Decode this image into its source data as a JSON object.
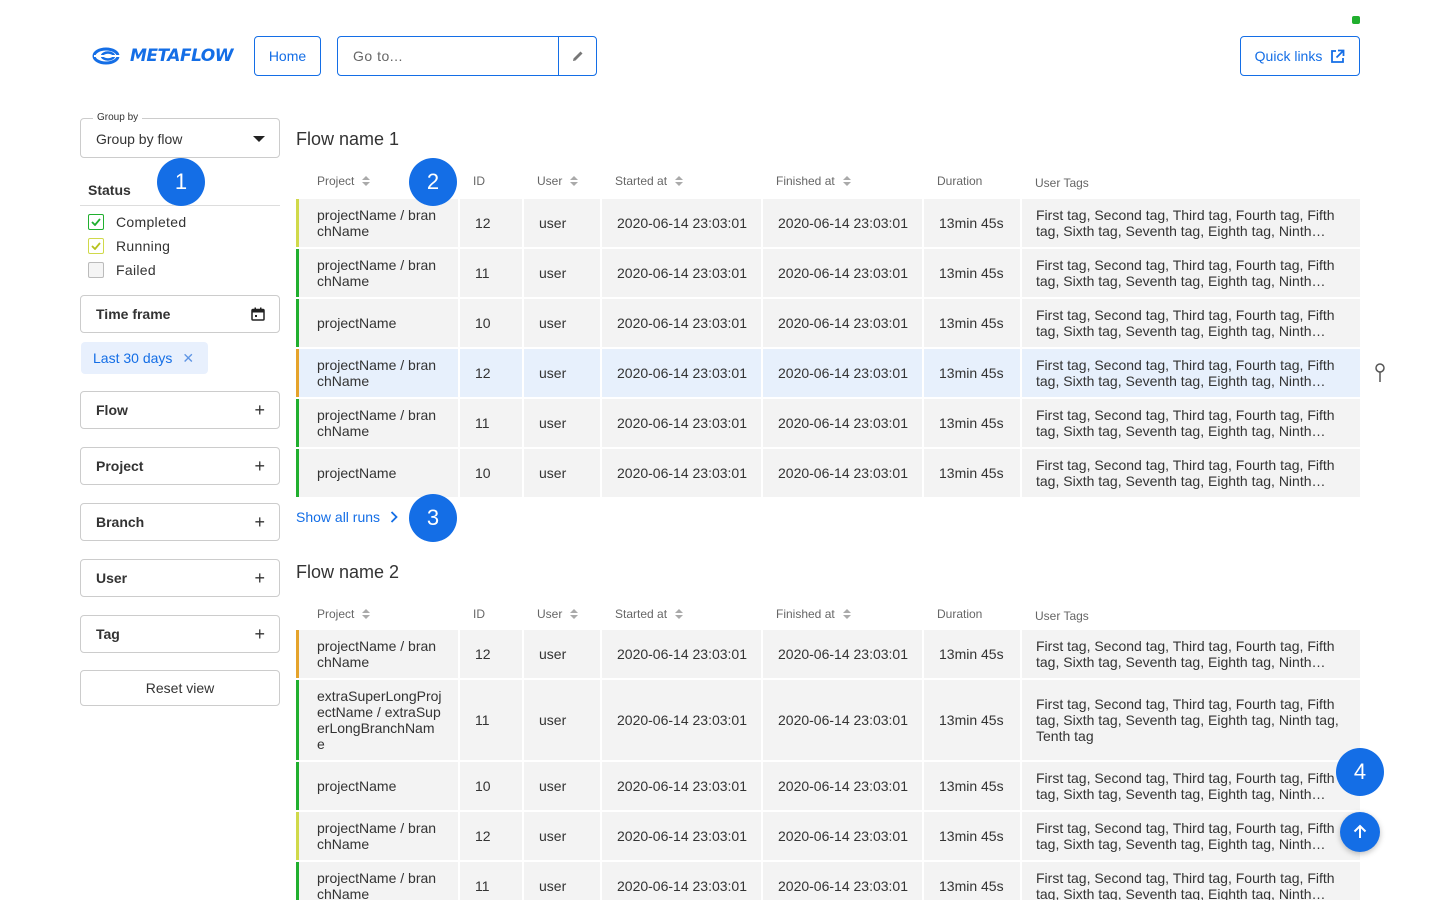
{
  "header": {
    "logo": "METAFLOW",
    "home_label": "Home",
    "goto_placeholder": "Go to...",
    "quick_links_label": "Quick links"
  },
  "sidebar": {
    "group_by": {
      "label": "Group by",
      "value": "Group by flow"
    },
    "status": {
      "title": "Status",
      "items": [
        {
          "label": "Completed",
          "checked": true,
          "color": "#20af2e"
        },
        {
          "label": "Running",
          "checked": true,
          "color": "#d0d94a"
        },
        {
          "label": "Failed",
          "checked": false
        }
      ]
    },
    "time_frame": {
      "label": "Time frame",
      "chip": "Last 30 days"
    },
    "filters": [
      "Flow",
      "Project",
      "Branch",
      "User",
      "Tag"
    ],
    "reset_label": "Reset view"
  },
  "columns": [
    "Project",
    "ID",
    "User",
    "Started at",
    "Finished at",
    "Duration",
    "User Tags"
  ],
  "groups": [
    {
      "title": "Flow name 1",
      "show_all_label": "Show all runs",
      "rows": [
        {
          "project": "projectName / branchName",
          "id": "12",
          "user": "user",
          "started": "2020-06-14 23:03:01",
          "finished": "2020-06-14 23:03:01",
          "duration": "13min 45s",
          "tags": "First tag, Second tag, Third tag, Fourth tag, Fifth tag, Sixth tag, Seventh tag, Eighth tag, Ninth tag,...",
          "status_color": "#d0d94a"
        },
        {
          "project": "projectName / branchName",
          "id": "11",
          "user": "user",
          "started": "2020-06-14 23:03:01",
          "finished": "2020-06-14 23:03:01",
          "duration": "13min 45s",
          "tags": "First tag, Second tag, Third tag, Fourth tag, Fifth tag, Sixth tag, Seventh tag, Eighth tag, Ninth tag,...",
          "status_color": "#20af2e"
        },
        {
          "project": "projectName",
          "id": "10",
          "user": "user",
          "started": "2020-06-14 23:03:01",
          "finished": "2020-06-14 23:03:01",
          "duration": "13min 45s",
          "tags": "First tag, Second tag, Third tag, Fourth tag, Fifth tag, Sixth tag, Seventh tag, Eighth tag, Ninth tag,...",
          "status_color": "#20af2e"
        },
        {
          "project": "projectName / branchName",
          "id": "12",
          "user": "user",
          "started": "2020-06-14 23:03:01",
          "finished": "2020-06-14 23:03:01",
          "duration": "13min 45s",
          "tags": "First tag, Second tag, Third tag, Fourth tag, Fifth tag, Sixth tag, Seventh tag, Eighth tag, Ninth tag,...",
          "status_color": "#e5a32b",
          "highlighted": true
        },
        {
          "project": "projectName / branchName",
          "id": "11",
          "user": "user",
          "started": "2020-06-14 23:03:01",
          "finished": "2020-06-14 23:03:01",
          "duration": "13min 45s",
          "tags": "First tag, Second tag, Third tag, Fourth tag, Fifth tag, Sixth tag, Seventh tag, Eighth tag, Ninth tag,...",
          "status_color": "#20af2e"
        },
        {
          "project": "projectName",
          "id": "10",
          "user": "user",
          "started": "2020-06-14 23:03:01",
          "finished": "2020-06-14 23:03:01",
          "duration": "13min 45s",
          "tags": "First tag, Second tag, Third tag, Fourth tag, Fifth tag, Sixth tag, Seventh tag, Eighth tag, Ninth tag,...",
          "status_color": "#20af2e"
        }
      ]
    },
    {
      "title": "Flow name 2",
      "rows": [
        {
          "project": "projectName / branchName",
          "id": "12",
          "user": "user",
          "started": "2020-06-14 23:03:01",
          "finished": "2020-06-14 23:03:01",
          "duration": "13min 45s",
          "tags": "First tag, Second tag, Third tag, Fourth tag, Fifth tag, Sixth tag, Seventh tag, Eighth tag, Ninth tag,...",
          "status_color": "#e5a32b"
        },
        {
          "project": "extraSuperLongProjectName / extraSuperLongBranchName",
          "id": "11",
          "user": "user",
          "started": "2020-06-14 23:03:01",
          "finished": "2020-06-14 23:03:01",
          "duration": "13min 45s",
          "tags": "First tag, Second tag, Third tag, Fourth tag, Fifth tag, Sixth tag, Seventh tag, Eighth tag, Ninth tag, Tenth tag",
          "status_color": "#20af2e",
          "full": true
        },
        {
          "project": "projectName",
          "id": "10",
          "user": "user",
          "started": "2020-06-14 23:03:01",
          "finished": "2020-06-14 23:03:01",
          "duration": "13min 45s",
          "tags": "First tag, Second tag, Third tag, Fourth tag, Fifth tag, Sixth tag, Seventh tag, Eighth tag, Ninth tag,...",
          "status_color": "#20af2e"
        },
        {
          "project": "projectName / branchName",
          "id": "12",
          "user": "user",
          "started": "2020-06-14 23:03:01",
          "finished": "2020-06-14 23:03:01",
          "duration": "13min 45s",
          "tags": "First tag, Second tag, Third tag, Fourth tag, Fifth tag, Sixth tag, Seventh tag, Eighth tag, Ninth tag,...",
          "status_color": "#d0d94a"
        },
        {
          "project": "projectName / branchName",
          "id": "11",
          "user": "user",
          "started": "2020-06-14 23:03:01",
          "finished": "2020-06-14 23:03:01",
          "duration": "13min 45s",
          "tags": "First tag, Second tag, Third tag, Fourth tag, Fifth tag, Sixth tag, Seventh tag, Eighth tag, Ninth tag,...",
          "status_color": "#20af2e"
        }
      ]
    }
  ],
  "annotations": [
    "1",
    "2",
    "3",
    "4"
  ],
  "colors": {
    "accent": "#146ee6",
    "completed": "#20af2e",
    "running": "#d0d94a",
    "warning": "#e5a32b"
  }
}
